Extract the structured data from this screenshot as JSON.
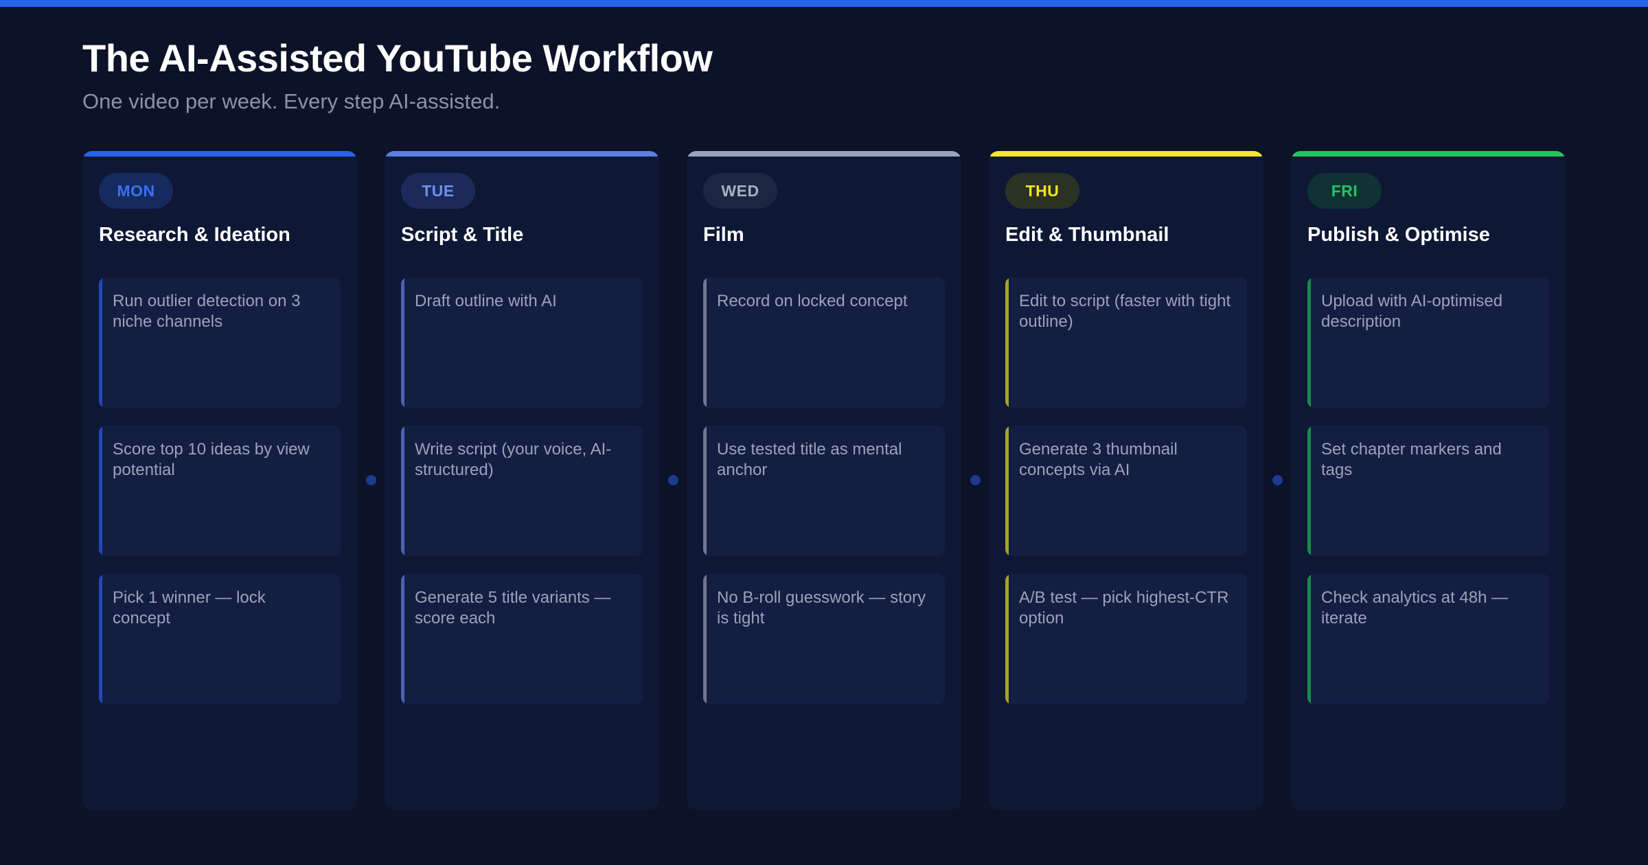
{
  "header": {
    "title": "The AI-Assisted YouTube Workflow",
    "subtitle": "One video per week. Every step AI-assisted."
  },
  "colors": {
    "background": "#0c1227",
    "top_bar": "#2563eb",
    "card": "#141e43",
    "column": "#0e1835"
  },
  "columns": [
    {
      "day": "MON",
      "title": "Research & Ideation",
      "accent": "#2563eb",
      "pill_bg": "#172a5e",
      "pill_text": "#3b6ff0",
      "stripe": "#2447b5",
      "tasks": [
        "Run outlier detection on 3 niche channels",
        "Score top 10 ideas by view potential",
        "Pick 1 winner — lock concept"
      ]
    },
    {
      "day": "TUE",
      "title": "Script & Title",
      "accent": "#5b7ee5",
      "pill_bg": "#1b2a5a",
      "pill_text": "#6f8ff0",
      "stripe": "#4a62b3",
      "tasks": [
        "Draft outline with AI",
        "Write script (your voice, AI-structured)",
        "Generate 5 title variants — score each"
      ]
    },
    {
      "day": "WED",
      "title": "Film",
      "accent": "#9aa3b7",
      "pill_bg": "#1d2640",
      "pill_text": "#a7afc2",
      "stripe": "#6f7891",
      "tasks": [
        "Record on locked concept",
        "Use tested title as mental anchor",
        "No B-roll guesswork — story is tight"
      ]
    },
    {
      "day": "THU",
      "title": "Edit & Thumbnail",
      "accent": "#f5e623",
      "pill_bg": "#2b3224",
      "pill_text": "#f5e623",
      "stripe": "#a7a12a",
      "tasks": [
        "Edit to script (faster with tight outline)",
        "Generate 3 thumbnail concepts via AI",
        "A/B test — pick highest-CTR option"
      ]
    },
    {
      "day": "FRI",
      "title": "Publish & Optimise",
      "accent": "#22c55e",
      "pill_bg": "#0f3335",
      "pill_text": "#22c55e",
      "stripe": "#1b8a4c",
      "tasks": [
        "Upload with AI-optimised description",
        "Set chapter markers and tags",
        "Check analytics at 48h — iterate"
      ]
    }
  ]
}
